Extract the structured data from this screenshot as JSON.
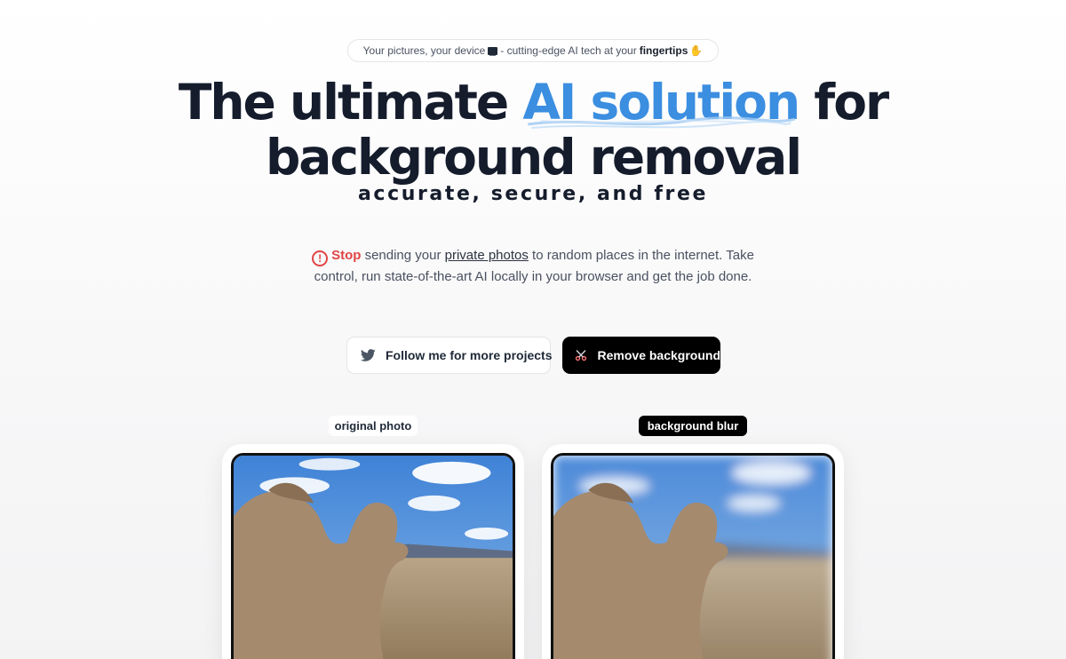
{
  "badge": {
    "text_before": "Your pictures, your device",
    "text_after": "- cutting-edge AI tech at your",
    "bold": "fingertips",
    "laptop_icon": "laptop-icon",
    "hand_icon": "waving-hand-icon"
  },
  "hero": {
    "line1_start": "The ultimate ",
    "line1_accent": "AI solution",
    "line1_end": " for",
    "line2": "background removal",
    "accent_color": "#3b8ee0"
  },
  "subline": "accurate, secure, and free",
  "description": {
    "stop": "Stop",
    "part1": " sending your ",
    "link": "private photos",
    "part2": " to random places in the internet. Take control, run state-of-the-art AI locally in your browser and get the job done.",
    "warn_icon": "exclamation-circle-icon"
  },
  "buttons": {
    "twitter": {
      "label": "Follow me for more projects",
      "icon": "twitter-icon"
    },
    "remove": {
      "label": "Remove background",
      "icon": "scissors-icon"
    }
  },
  "comparison": {
    "left_label": "original photo",
    "right_label": "background blur"
  },
  "colors": {
    "stop_red": "#e04444",
    "title_dark": "#151c2c"
  }
}
